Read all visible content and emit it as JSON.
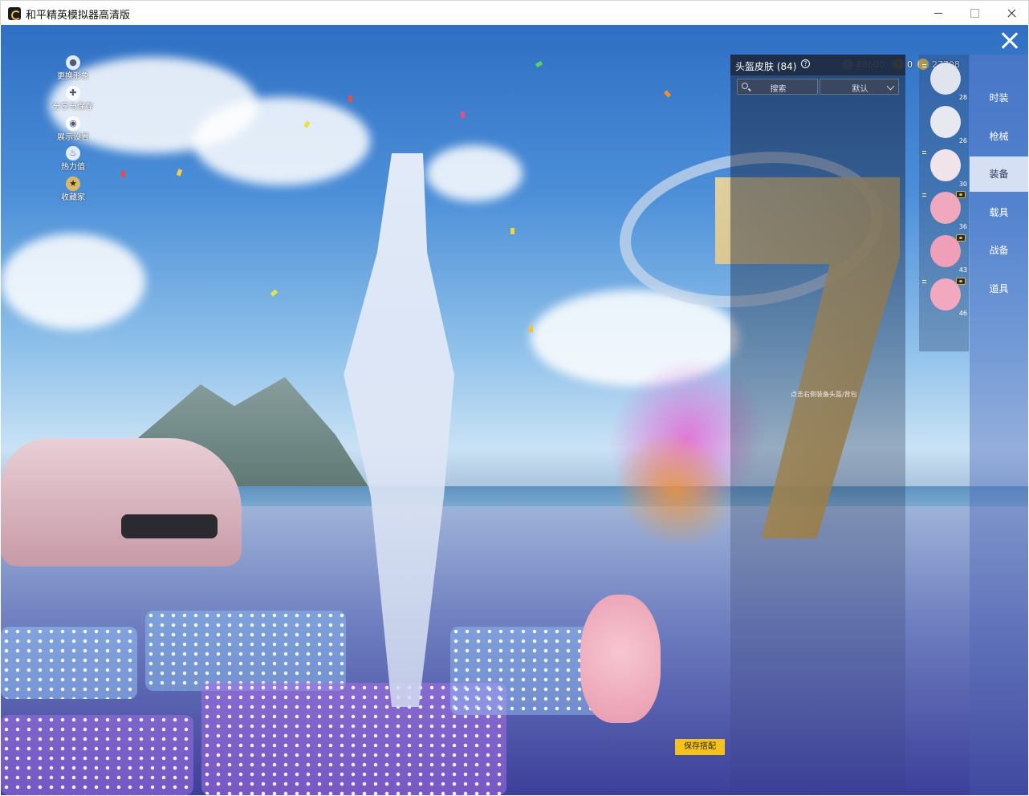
{
  "window": {
    "title": "和平精英模拟器高清版"
  },
  "hud": {
    "left_menu": [
      {
        "label": "更换形象",
        "icon": "avatar-icon"
      },
      {
        "label": "分享与保存",
        "icon": "share-icon"
      },
      {
        "label": "展示设置",
        "icon": "eye-icon"
      },
      {
        "label": "热力值",
        "icon": "fire-icon"
      },
      {
        "label": "收藏家",
        "icon": "collector-badge-icon"
      }
    ],
    "currency": [
      {
        "value": "88600",
        "icon": "coupon-icon",
        "color": "#8fa3c8"
      },
      {
        "value": "0",
        "icon": "gold-badge-icon",
        "color": "#c9a54a"
      },
      {
        "value": "27708",
        "icon": "coin-icon",
        "color": "#e7c24a"
      }
    ]
  },
  "panel": {
    "title": "头盔皮肤 (84)",
    "search_label": "搜索",
    "sort_label": "默认",
    "hint": "点击右侧装备头盔/背包"
  },
  "items": [
    {
      "count": "28",
      "equipped_mark": true,
      "eye": false,
      "color": "#dfe4ee"
    },
    {
      "count": "26",
      "equipped_mark": false,
      "eye": false,
      "color": "#e6e9ef"
    },
    {
      "count": "30",
      "equipped_mark": true,
      "eye": false,
      "color": "#f0e4ea"
    },
    {
      "count": "36",
      "equipped_mark": true,
      "eye": true,
      "color": "#f0a8bf"
    },
    {
      "count": "43",
      "equipped_mark": false,
      "eye": true,
      "color": "#ef9fb8"
    },
    {
      "count": "46",
      "equipped_mark": true,
      "eye": true,
      "color": "#f2a9c0"
    }
  ],
  "tabs": [
    {
      "label": "时装",
      "active": false
    },
    {
      "label": "枪械",
      "active": false
    },
    {
      "label": "装备",
      "active": true
    },
    {
      "label": "载具",
      "active": false
    },
    {
      "label": "战备",
      "active": false
    },
    {
      "label": "道具",
      "active": false
    }
  ],
  "save_button": "保存搭配"
}
